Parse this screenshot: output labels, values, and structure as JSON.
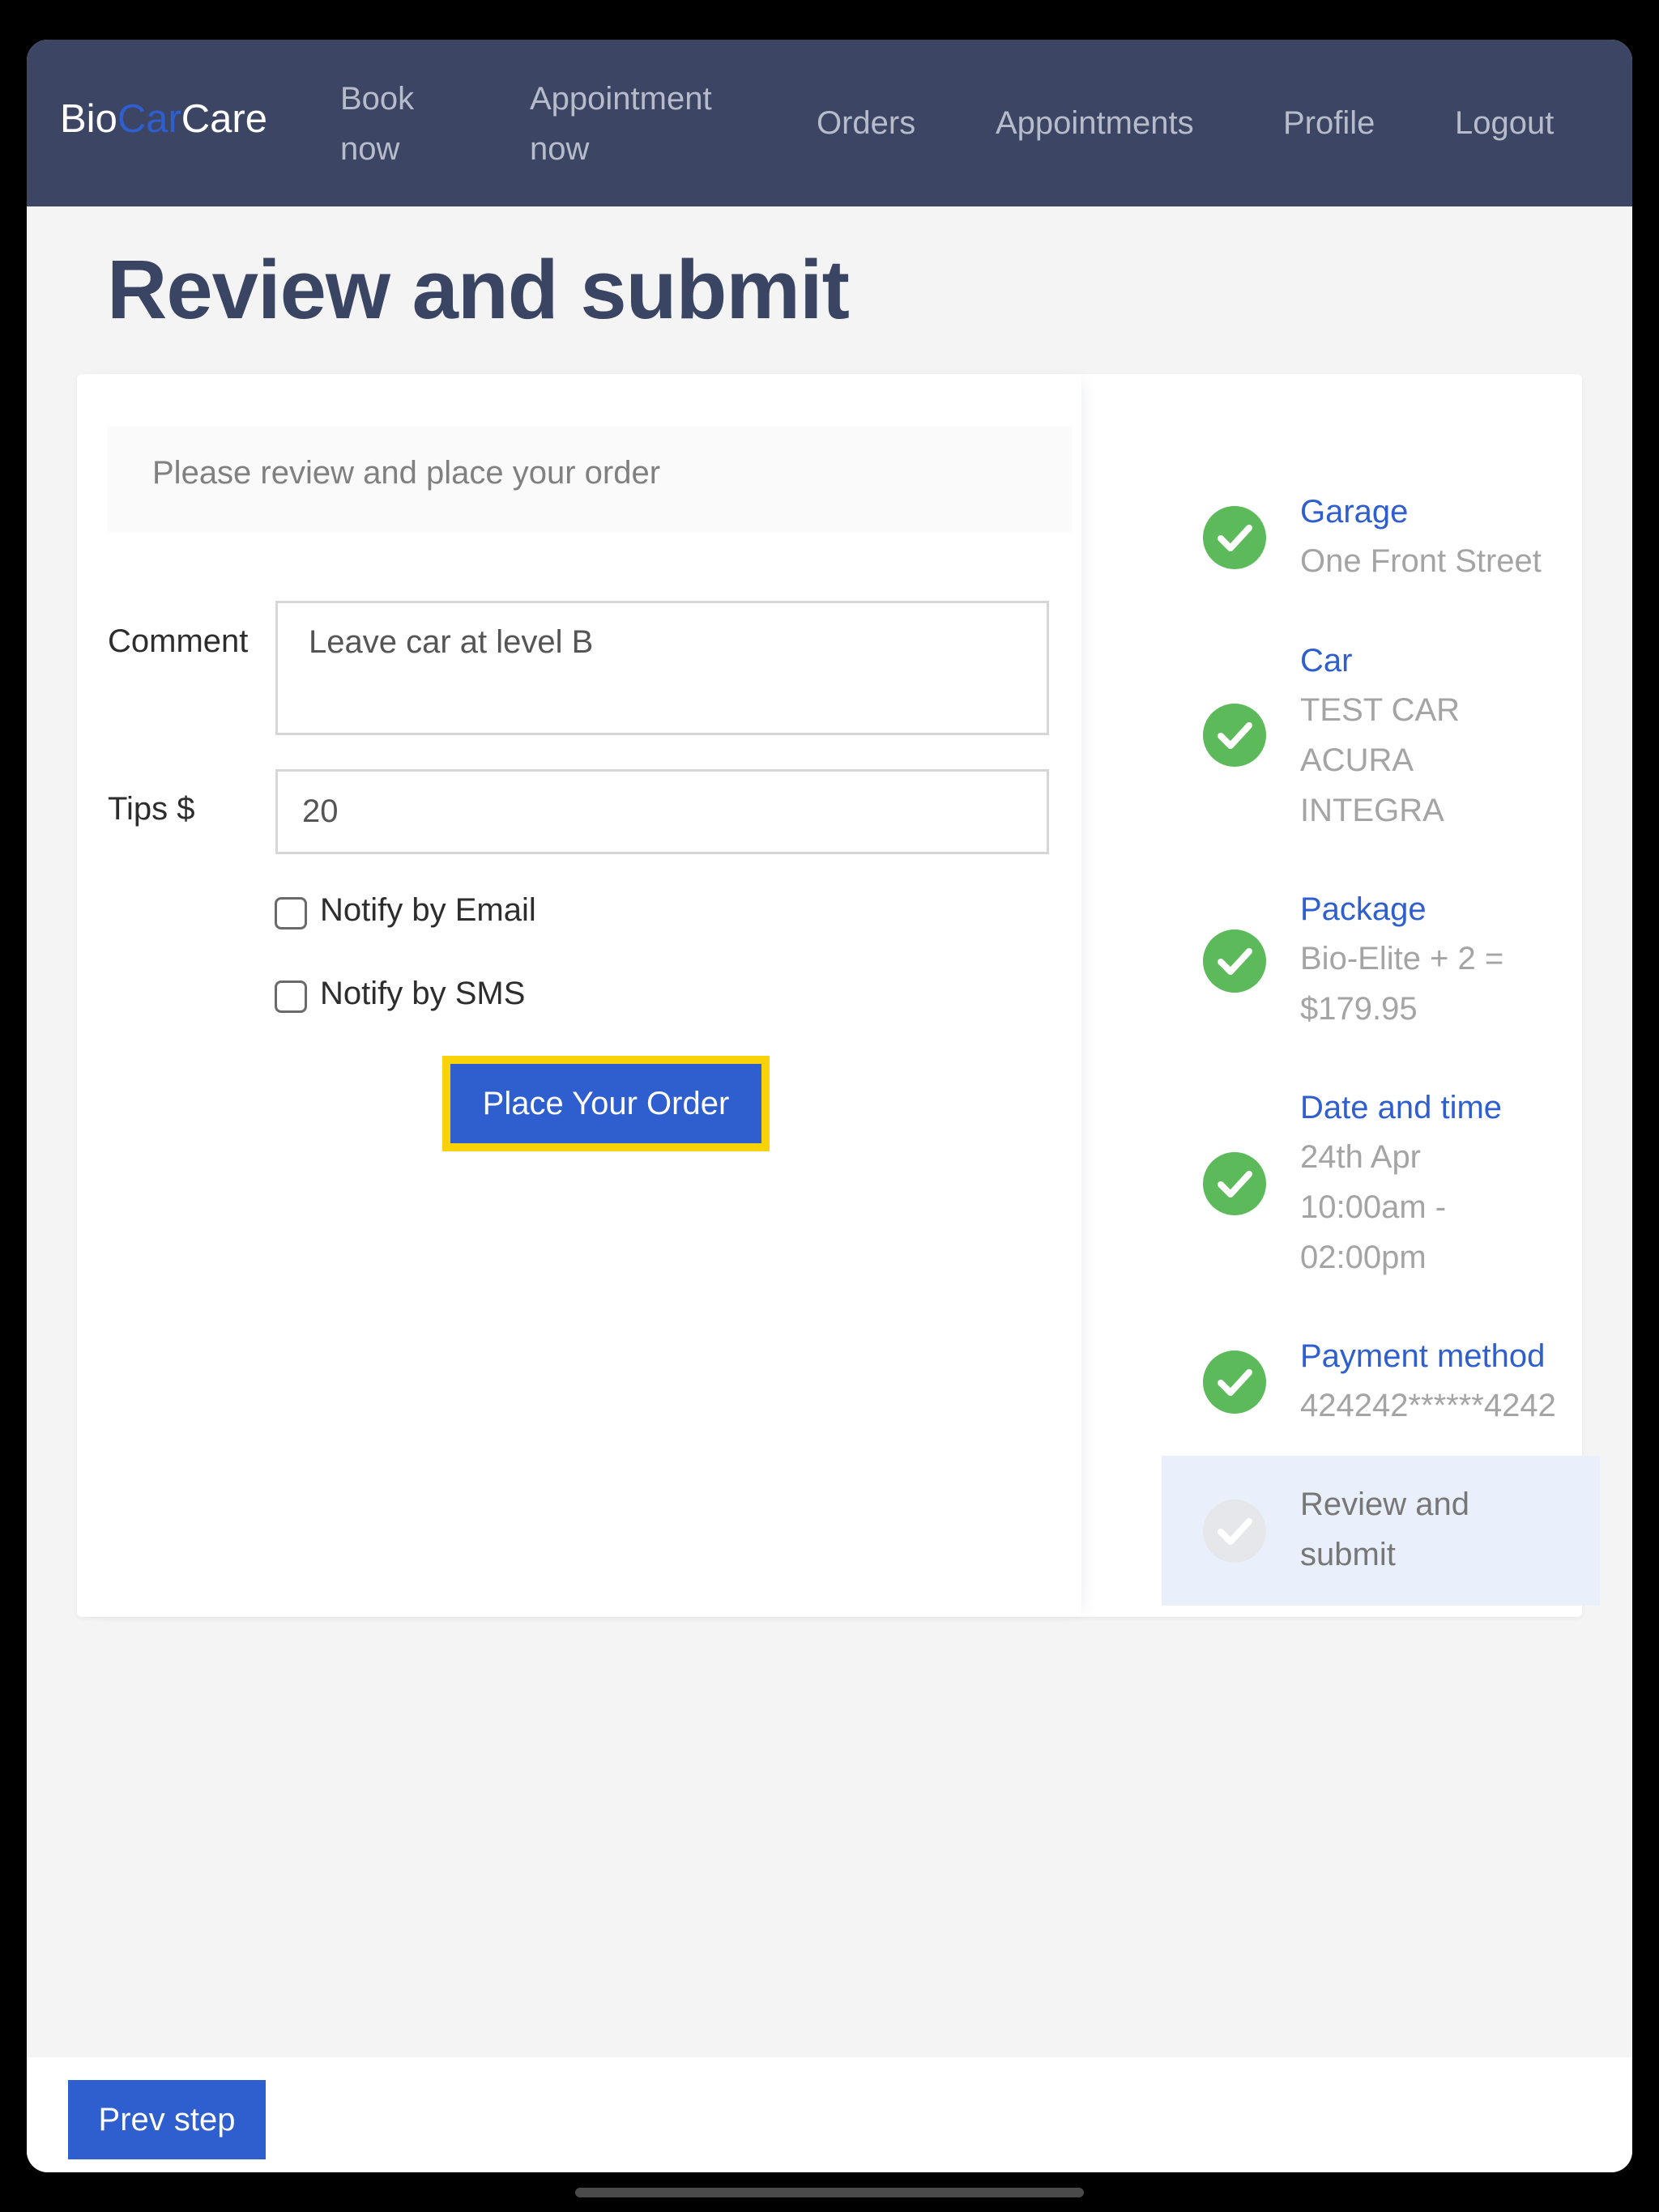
{
  "brand": {
    "part1": "Bio",
    "part2": "Car",
    "part3": "Care"
  },
  "nav": {
    "book_line1": "Book",
    "book_line2": "now",
    "appt_line1": "Appointment",
    "appt_line2": "now",
    "orders": "Orders",
    "appointments": "Appointments",
    "profile": "Profile",
    "logout": "Logout"
  },
  "page": {
    "title": "Review and submit"
  },
  "form": {
    "info": "Please review and place your order",
    "comment_label": "Comment",
    "comment_value": "Leave car at level B",
    "tips_label": "Tips $",
    "tips_value": "20",
    "notify_email_label": "Notify by Email",
    "notify_email_checked": false,
    "notify_sms_label": "Notify by SMS",
    "notify_sms_checked": false,
    "submit_label": "Place Your Order"
  },
  "steps": {
    "garage": {
      "title": "Garage",
      "value": "One Front Street"
    },
    "car": {
      "title": "Car",
      "line1": "TEST CAR",
      "line2": "ACURA",
      "line3": "INTEGRA"
    },
    "package": {
      "title": "Package",
      "line1": "Bio-Elite + 2 =",
      "line2": "$179.95"
    },
    "datetime": {
      "title": "Date and time",
      "line1": "24th Apr",
      "line2": "10:00am -",
      "line3": "02:00pm"
    },
    "payment": {
      "title": "Payment method",
      "value": "424242******4242"
    },
    "review": {
      "line1": "Review and",
      "line2": "submit"
    }
  },
  "footer": {
    "prev_label": "Prev step"
  },
  "colors": {
    "navbar": "#3c4563",
    "accent": "#2f5ecf",
    "highlight": "#f9d20a",
    "check_green": "#5cba5a"
  },
  "icons": {
    "step_done": "check-circle-icon",
    "step_pending": "check-circle-icon"
  }
}
